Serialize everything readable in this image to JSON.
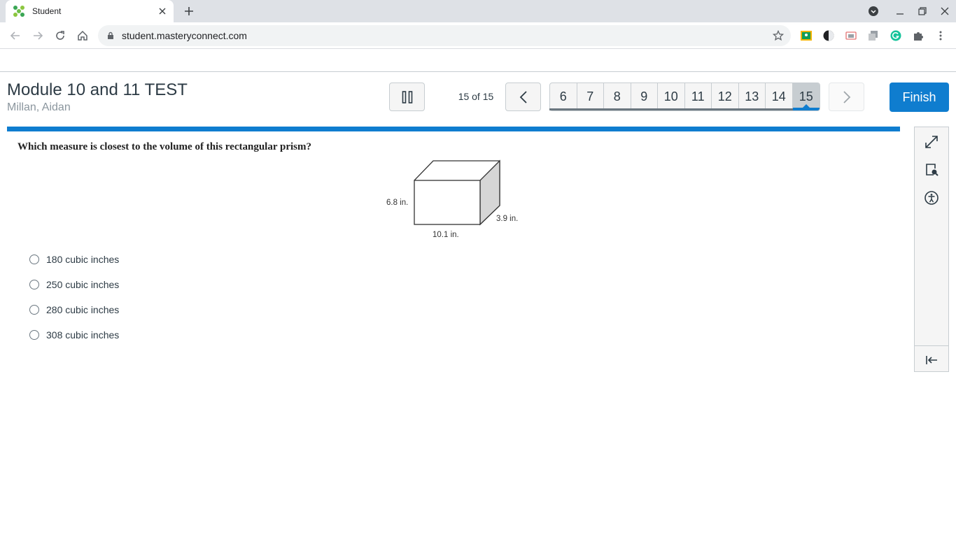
{
  "browser": {
    "tab_title": "Student",
    "url": "student.masteryconnect.com"
  },
  "header": {
    "test_title": "Module 10 and 11 TEST",
    "student_name": "Millan, Aidan",
    "progress_text": "15 of 15",
    "question_numbers": [
      "6",
      "7",
      "8",
      "9",
      "10",
      "11",
      "12",
      "13",
      "14",
      "15"
    ],
    "current_question": "15",
    "finish_label": "Finish"
  },
  "question": {
    "prompt": "Which measure is closest to the volume of this rectangular prism?",
    "figure": {
      "height_label": "6.8 in.",
      "depth_label": "3.9 in.",
      "width_label": "10.1 in."
    },
    "choices": [
      "180 cubic inches",
      "250 cubic inches",
      "280 cubic inches",
      "308 cubic inches"
    ]
  },
  "colors": {
    "accent": "#0f7dcf",
    "border": "#c7cdd1",
    "text": "#2d3b45",
    "muted": "#8b969e"
  },
  "icons": {
    "tools": [
      "expand-icon",
      "magnifier-document-icon",
      "accessibility-icon",
      "collapse-panel-icon"
    ]
  }
}
